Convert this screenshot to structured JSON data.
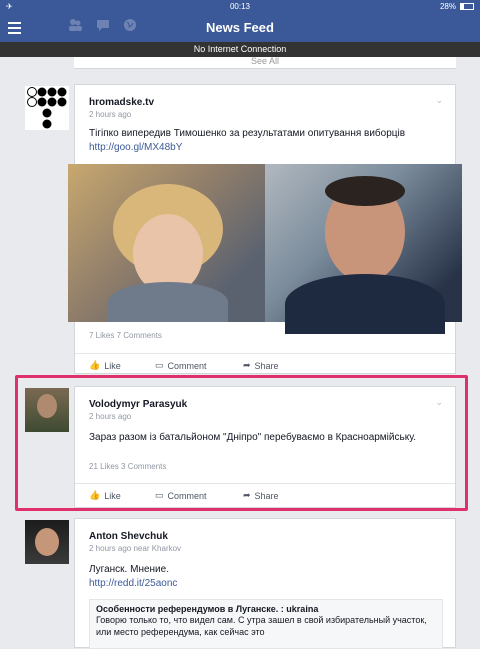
{
  "status_bar": {
    "airplane": "✈",
    "time": "00:13",
    "battery_pct": "28%",
    "battery_level": 0.28
  },
  "nav": {
    "title": "News Feed",
    "icons": [
      "menu-icon",
      "friends-icon",
      "messages-icon",
      "globe-icon"
    ]
  },
  "banner": {
    "text": "No Internet Connection"
  },
  "see_all": "See All",
  "posts": [
    {
      "author": "hromadske.tv",
      "meta": "2 hours ago",
      "text": "Тігіпко випередив Тимошенко за результатами опитування виборців",
      "link": "http://goo.gl/MX48bY",
      "counts": "7 Likes  7 Comments",
      "actions": [
        "Like",
        "Comment",
        "Share"
      ]
    },
    {
      "author": "Volodymyr Parasyuk",
      "meta": "2 hours ago",
      "text": "Зараз разом із батальйоном \"Дніпро\" перебуваємо в Красноармійську.",
      "counts": "21 Likes  3 Comments",
      "actions": [
        "Like",
        "Comment",
        "Share"
      ]
    },
    {
      "author": "Anton Shevchuk",
      "meta": "2 hours ago near Kharkov",
      "text": "Луганск. Мнение.",
      "link": "http://redd.it/25aonc",
      "preview_title": "Особенности референдумов в Луганске. : ukraina",
      "preview_text": "Говорю только то, что видел сам. С утра зашел в свой избирательный участок, или место референдума, как сейчас это"
    }
  ]
}
